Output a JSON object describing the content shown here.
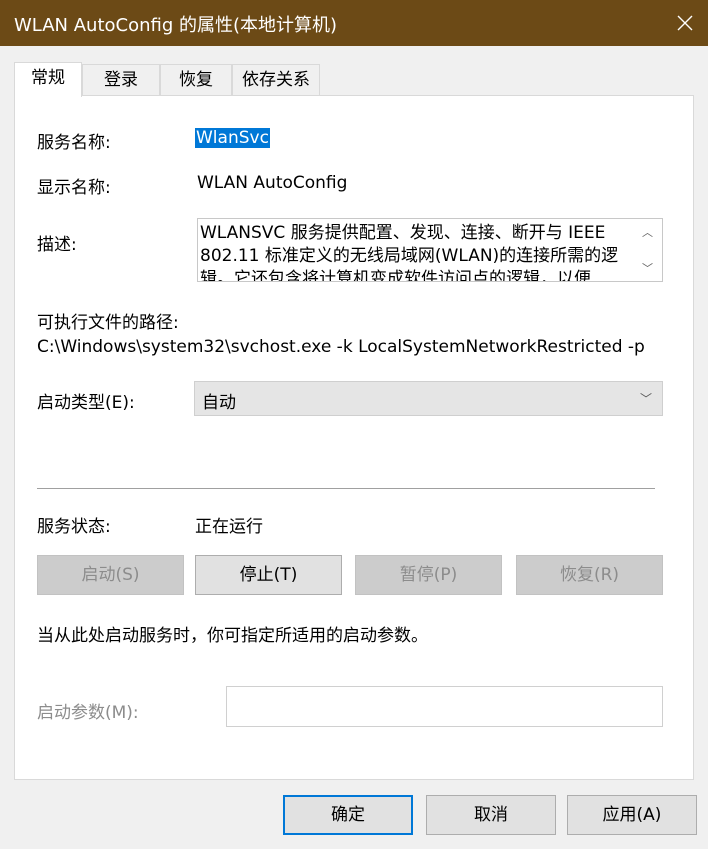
{
  "window": {
    "title": "WLAN AutoConfig 的属性(本地计算机)"
  },
  "tabs": [
    "常规",
    "登录",
    "恢复",
    "依存关系"
  ],
  "general": {
    "service_name_label": "服务名称:",
    "service_name_value": "WlanSvc",
    "display_name_label": "显示名称:",
    "display_name_value": "WLAN AutoConfig",
    "description_label": "描述:",
    "description_value": "WLANSVC 服务提供配置、发现、连接、断开与 IEEE 802.11 标准定义的无线局域网(WLAN)的连接所需的逻辑。它还包含将计算机变成软件访问点的逻辑，以便",
    "exe_path_label": "可执行文件的路径:",
    "exe_path_value": "C:\\Windows\\system32\\svchost.exe -k LocalSystemNetworkRestricted -p",
    "startup_type_label": "启动类型(E):",
    "startup_type_value": "自动",
    "service_status_label": "服务状态:",
    "service_status_value": "正在运行",
    "buttons": {
      "start": "启动(S)",
      "stop": "停止(T)",
      "pause": "暂停(P)",
      "resume": "恢复(R)"
    },
    "hint_text": "当从此处启动服务时，你可指定所适用的启动参数。",
    "start_params_label": "启动参数(M):",
    "start_params_value": ""
  },
  "footer": {
    "ok": "确定",
    "cancel": "取消",
    "apply": "应用(A)"
  }
}
